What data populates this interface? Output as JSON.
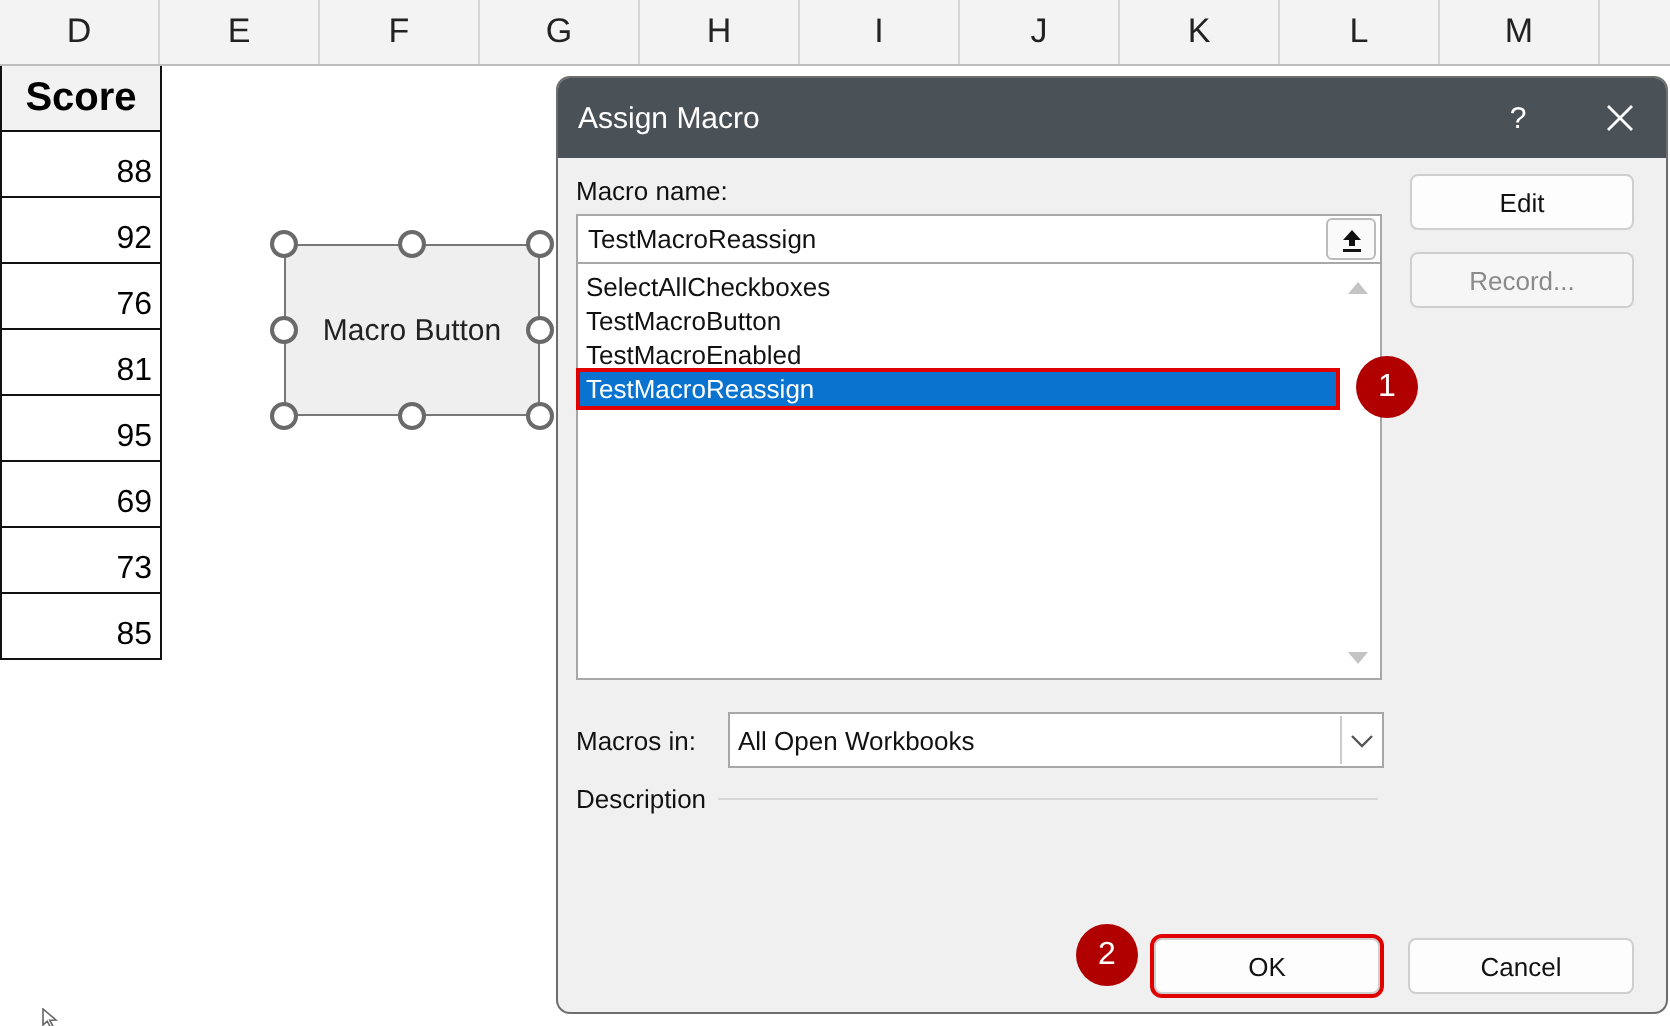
{
  "sheet": {
    "columns": [
      "D",
      "E",
      "F",
      "G",
      "H",
      "I",
      "J",
      "K",
      "L",
      "M"
    ],
    "header": "Score",
    "rows": [
      "88",
      "92",
      "76",
      "81",
      "95",
      "69",
      "73",
      "85"
    ]
  },
  "shape": {
    "label": "Macro Button",
    "selected": true
  },
  "dialog": {
    "title": "Assign Macro",
    "help": "?",
    "macro_name_label": "Macro name:",
    "macro_name_value": "TestMacroReassign",
    "macros": [
      {
        "name": "SelectAllCheckboxes",
        "selected": false,
        "highlighted": false
      },
      {
        "name": "TestMacroButton",
        "selected": false,
        "highlighted": false
      },
      {
        "name": "TestMacroEnabled",
        "selected": false,
        "highlighted": false
      },
      {
        "name": "TestMacroReassign",
        "selected": true,
        "highlighted": true
      }
    ],
    "side_buttons": [
      {
        "label": "Edit",
        "disabled": false
      },
      {
        "label": "Record...",
        "disabled": true
      }
    ],
    "macros_in_label": "Macros in:",
    "macros_in_value": "All Open Workbooks",
    "description_label": "Description",
    "footer_buttons": [
      {
        "label": "OK",
        "highlighted": true
      },
      {
        "label": "Cancel",
        "highlighted": false
      }
    ]
  },
  "callouts": [
    {
      "number": "1"
    },
    {
      "number": "2"
    }
  ]
}
